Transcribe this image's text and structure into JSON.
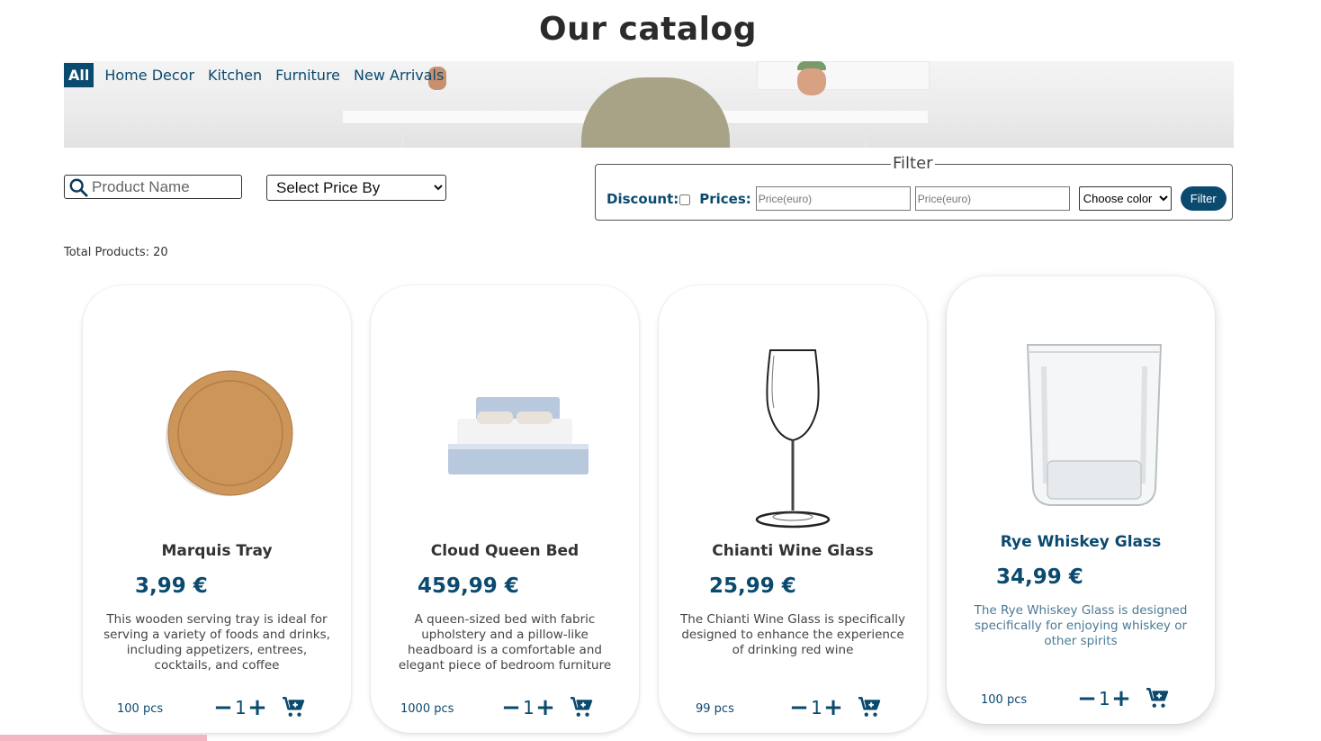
{
  "page": {
    "title": "Our catalog"
  },
  "tabs": [
    "All",
    "Home Decor",
    "Kitchen",
    "Furniture",
    "New Arrivals"
  ],
  "search": {
    "placeholder": "Product Name"
  },
  "price_select": {
    "selected": "Select Price By"
  },
  "filter": {
    "legend": "Filter",
    "discount_label": "Discount:",
    "prices_label": "Prices:",
    "min_placeholder": "Price(euro)",
    "max_placeholder": "Price(euro)",
    "color_selected": "Choose color",
    "button": "Filter"
  },
  "total": "Total Products: 20",
  "products": [
    {
      "name": "Marquis Tray",
      "price": "3,99 €",
      "description": "This wooden serving tray is ideal for serving a variety of foods and drinks, including appetizers, entrees, cocktails, and coffee",
      "stock": "100 pcs",
      "qty": "1",
      "image": "wooden-tray"
    },
    {
      "name": "Cloud Queen Bed",
      "price": "459,99 €",
      "description": "A queen-sized bed with fabric upholstery and a pillow-like headboard is a comfortable and elegant piece of bedroom furniture",
      "stock": "1000 pcs",
      "qty": "1",
      "image": "bed"
    },
    {
      "name": "Chianti Wine Glass",
      "price": "25,99 €",
      "description": "The Chianti Wine Glass is specifically designed to enhance the experience of drinking red wine",
      "stock": "99 pcs",
      "qty": "1",
      "image": "wine-glass"
    },
    {
      "name": "Rye Whiskey Glass",
      "price": "34,99 €",
      "description": "The Rye Whiskey Glass is designed specifically for enjoying whiskey or other spirits",
      "stock": "100 pcs",
      "qty": "1",
      "image": "whiskey-glass"
    }
  ],
  "icons": {
    "minus": "−",
    "plus": "+"
  },
  "colors": {
    "accent": "#0b4a6f",
    "text": "#333333"
  }
}
